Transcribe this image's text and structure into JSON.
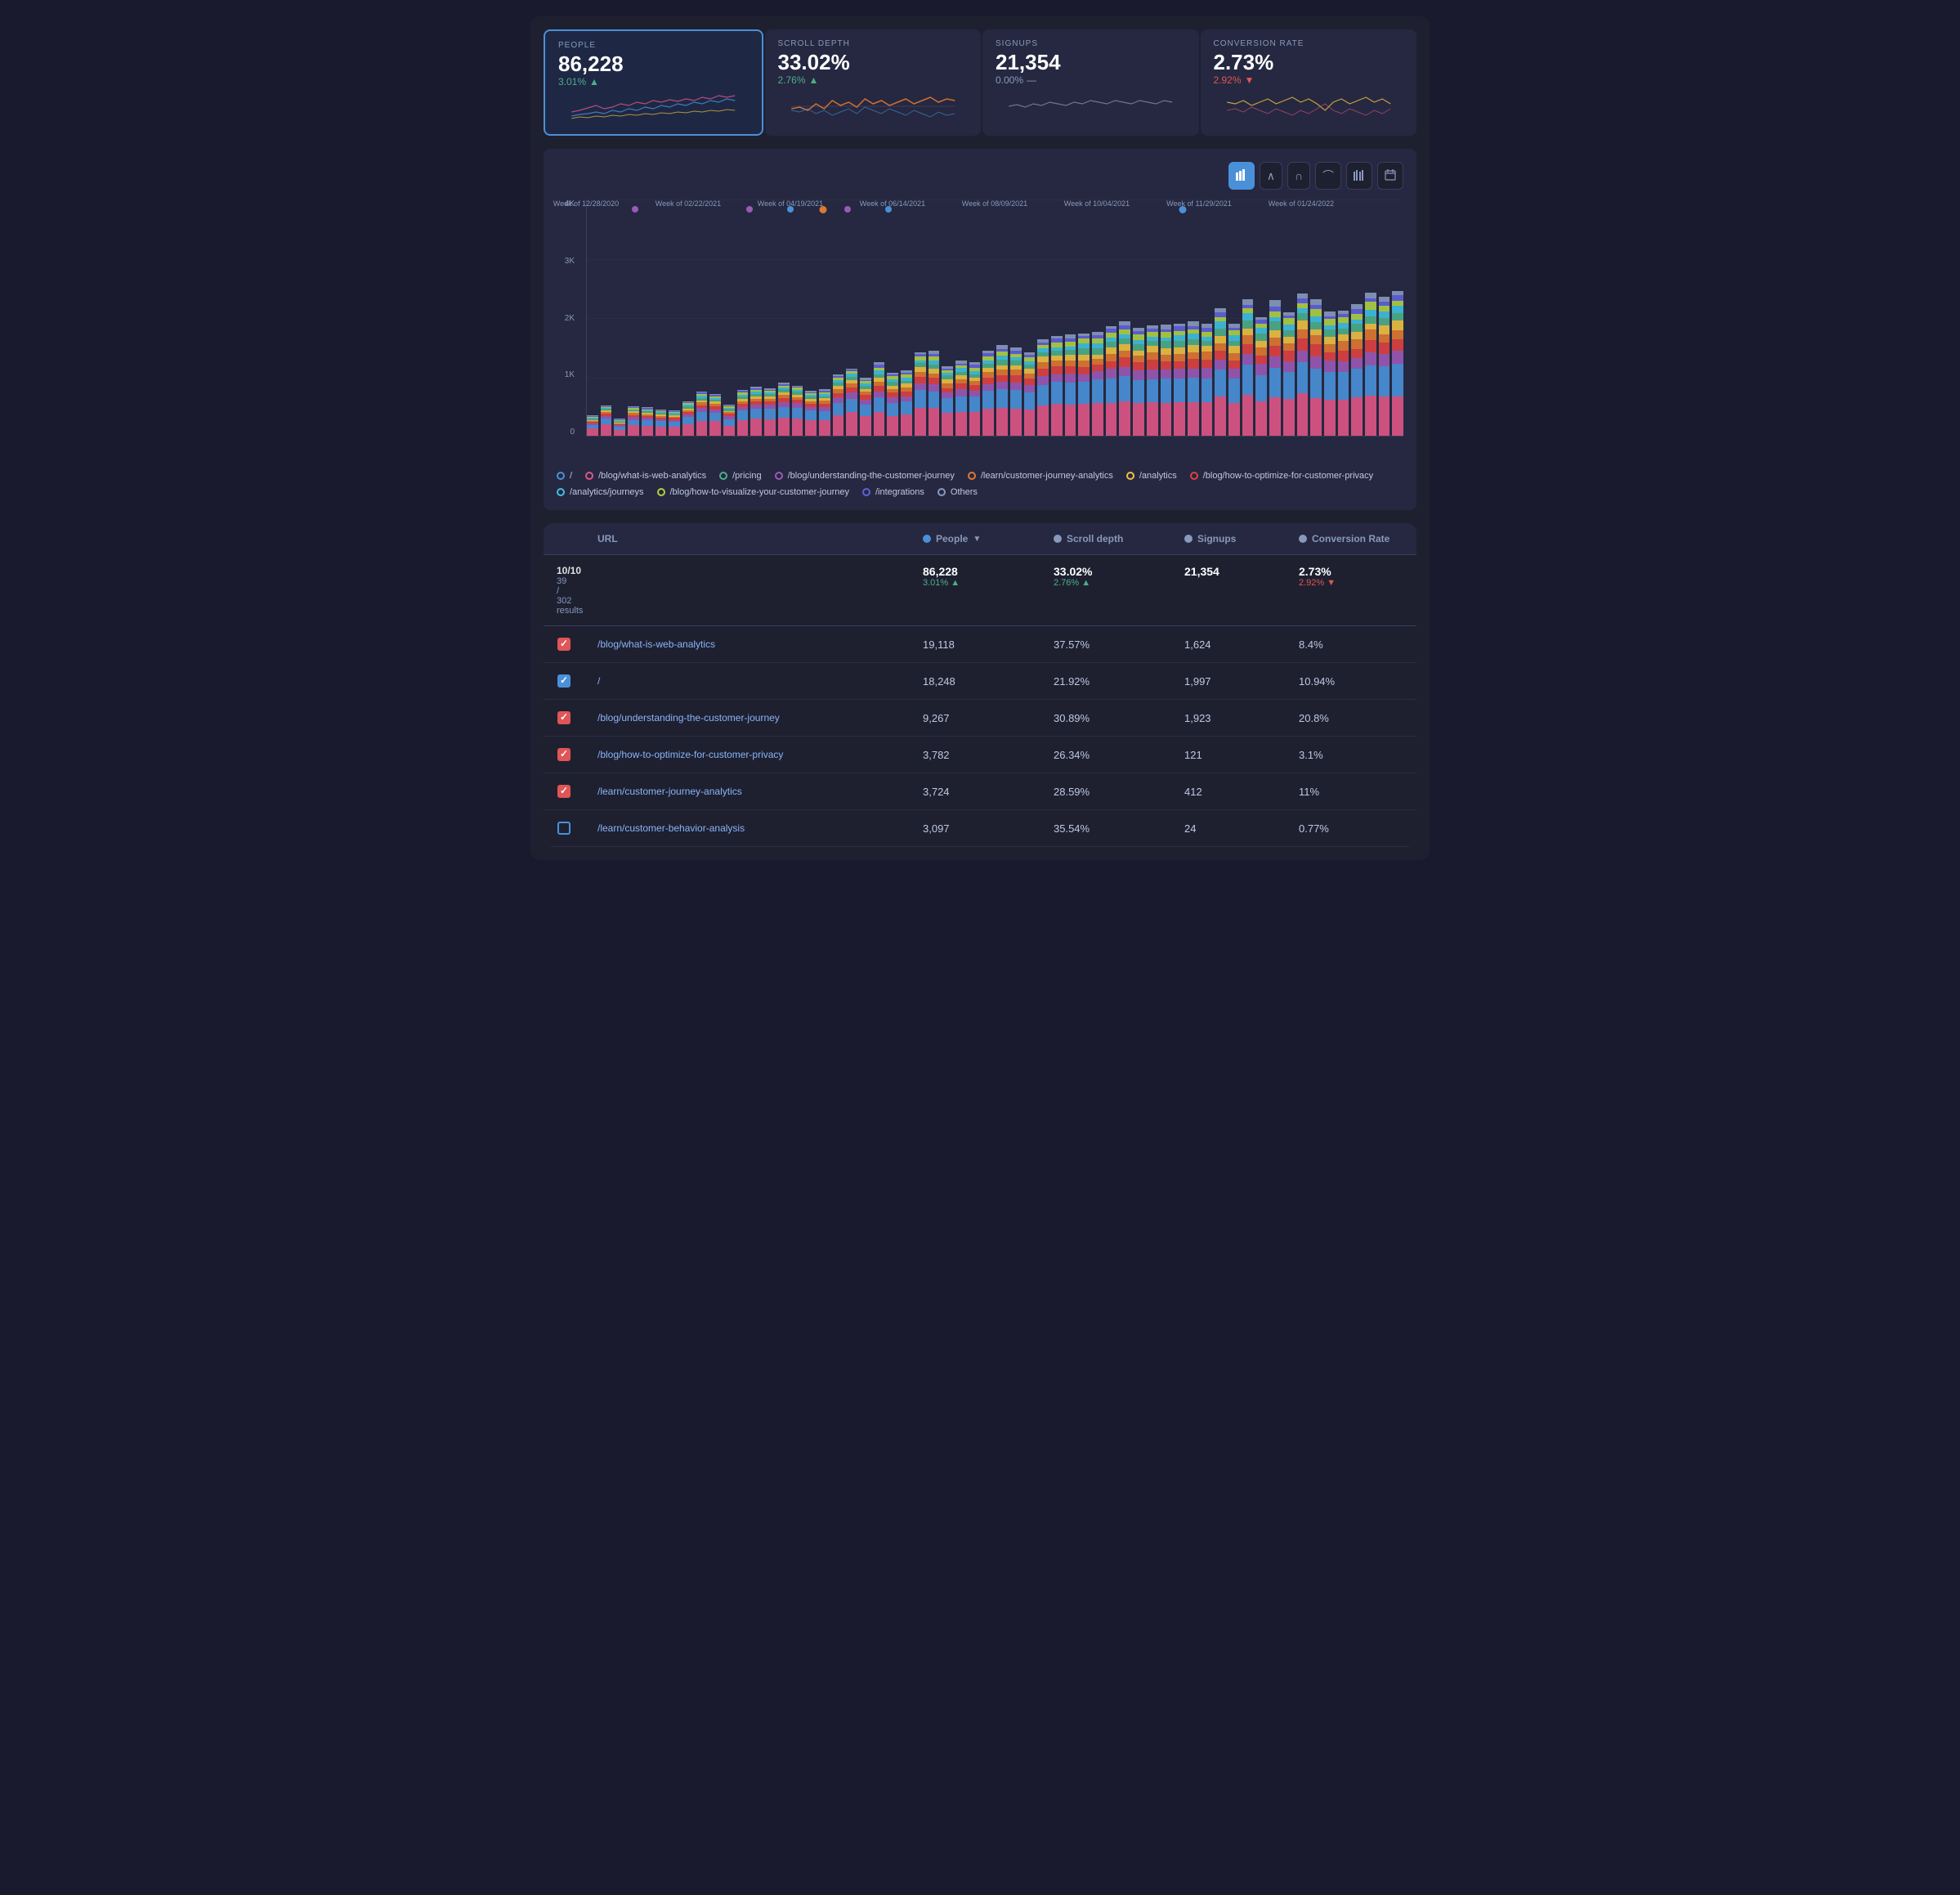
{
  "metrics": [
    {
      "id": "people",
      "label": "PEOPLE",
      "value": "86,228",
      "change": "3.01%",
      "direction": "up",
      "active": true
    },
    {
      "id": "scroll_depth",
      "label": "SCROLL DEPTH",
      "value": "33.02%",
      "change": "2.76%",
      "direction": "up",
      "active": false
    },
    {
      "id": "signups",
      "label": "SIGNUPS",
      "value": "21,354",
      "change": "0.00%",
      "direction": "neutral",
      "active": false
    },
    {
      "id": "conversion_rate",
      "label": "CONVERSION RATE",
      "value": "2.73%",
      "change": "2.92%",
      "direction": "down",
      "active": false
    }
  ],
  "toolbar_buttons": [
    {
      "id": "bar",
      "icon": "▮▮",
      "active": true
    },
    {
      "id": "line1",
      "icon": "∧",
      "active": false
    },
    {
      "id": "line2",
      "icon": "∩",
      "active": false
    },
    {
      "id": "area",
      "icon": "⌒",
      "active": false
    },
    {
      "id": "grouped",
      "icon": "▐▌",
      "active": false
    },
    {
      "id": "calendar",
      "icon": "🗓",
      "active": false
    }
  ],
  "y_axis_labels": [
    "4K",
    "3K",
    "2K",
    "1K",
    "0"
  ],
  "x_axis_labels": [
    "Week of 12/28/2020",
    "Week of 02/22/2021",
    "Week of 04/19/2021",
    "Week of 06/14/2021",
    "Week of 08/09/2021",
    "Week of 10/04/2021",
    "Week of 11/29/2021",
    "Week of 01/24/2022"
  ],
  "legend": [
    {
      "label": "/",
      "color": "#4a90d9",
      "border": "#4a90d9",
      "filled": false
    },
    {
      "label": "/blog/what-is-web-analytics",
      "color": "#e05585",
      "border": "#e05585",
      "filled": false
    },
    {
      "label": "/pricing",
      "color": "#4caf8a",
      "border": "#4caf8a",
      "filled": false
    },
    {
      "label": "/blog/understanding-the-customer-journey",
      "color": "#9b59b6",
      "border": "#9b59b6",
      "filled": false
    },
    {
      "label": "/learn/customer-journey-analytics",
      "color": "#e07830",
      "border": "#e07830",
      "filled": false
    },
    {
      "label": "/analytics",
      "color": "#f0c040",
      "border": "#f0c040",
      "filled": false
    },
    {
      "label": "/blog/how-to-optimize-for-customer-privacy",
      "color": "#e04040",
      "border": "#e04040",
      "filled": false
    },
    {
      "label": "/analytics/journeys",
      "color": "#40c0e0",
      "border": "#40c0e0",
      "filled": false
    },
    {
      "label": "/blog/how-to-visualize-your-customer-journey",
      "color": "#b0d040",
      "border": "#b0d040",
      "filled": false
    },
    {
      "label": "/integrations",
      "color": "#6060e0",
      "border": "#6060e0",
      "filled": false
    },
    {
      "label": "Others",
      "color": "#8899bb",
      "border": "#8899bb",
      "filled": false
    }
  ],
  "table": {
    "columns": [
      "",
      "URL",
      "People",
      "Scroll depth",
      "Signups",
      "Conversion Rate"
    ],
    "people_dot_color": "#4a90d9",
    "scroll_dot_color": "#8899bb",
    "signups_dot_color": "#8899bb",
    "conversion_dot_color": "#8899bb",
    "summary": {
      "range": "10/10",
      "results": "39 / 302 results",
      "people_value": "86,228",
      "people_change": "3.01%",
      "people_direction": "up",
      "scroll_value": "33.02%",
      "scroll_change": "2.76%",
      "scroll_direction": "up",
      "signups_value": "21,354",
      "conversion_value": "2.73%",
      "conversion_change": "2.92%",
      "conversion_direction": "down"
    },
    "rows": [
      {
        "checked": "red",
        "url": "/blog/what-is-web-analytics",
        "people": "19,118",
        "scroll": "37.57%",
        "signups": "1,624",
        "conversion": "8.4%"
      },
      {
        "checked": "blue",
        "url": "/",
        "people": "18,248",
        "scroll": "21.92%",
        "signups": "1,997",
        "conversion": "10.94%"
      },
      {
        "checked": "red",
        "url": "/blog/understanding-the-customer-journey",
        "people": "9,267",
        "scroll": "30.89%",
        "signups": "1,923",
        "conversion": "20.8%"
      },
      {
        "checked": "red",
        "url": "/blog/how-to-optimize-for-customer-privacy",
        "people": "3,782",
        "scroll": "26.34%",
        "signups": "121",
        "conversion": "3.1%"
      },
      {
        "checked": "red",
        "url": "/learn/customer-journey-analytics",
        "people": "3,724",
        "scroll": "28.59%",
        "signups": "412",
        "conversion": "11%"
      },
      {
        "checked": "unchecked",
        "url": "/learn/customer-behavior-analysis",
        "people": "3,097",
        "scroll": "35.54%",
        "signups": "24",
        "conversion": "0.77%"
      }
    ]
  }
}
